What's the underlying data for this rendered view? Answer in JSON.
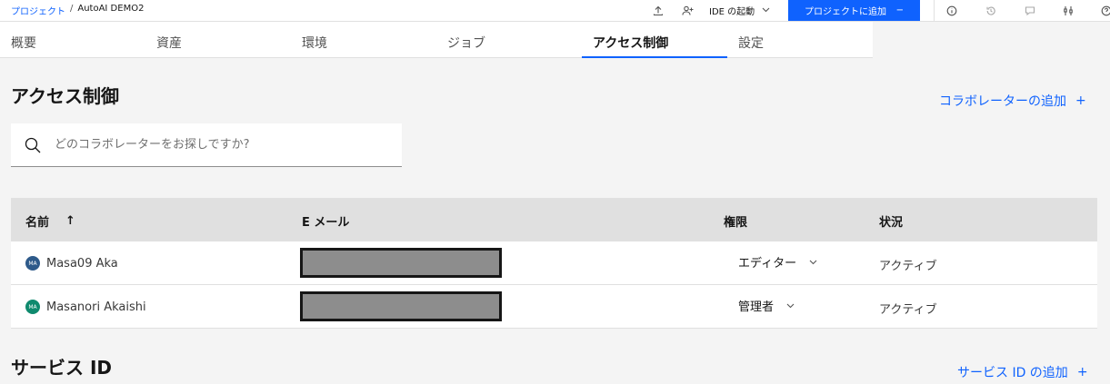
{
  "breadcrumb": {
    "root": "プロジェクト",
    "separator": "/",
    "current": "AutoAI DEMO2"
  },
  "toolbar": {
    "ide_label": "IDE の起動",
    "add_project_label": "プロジェクトに追加",
    "add_project_icon": "−",
    "icons": [
      "upload-icon",
      "add-user-icon",
      "info-icon",
      "history-icon",
      "comment-icon",
      "settings-adjust-icon",
      "help-icon"
    ]
  },
  "tabs": [
    {
      "label": "概要",
      "active": false
    },
    {
      "label": "資産",
      "active": false
    },
    {
      "label": "環境",
      "active": false
    },
    {
      "label": "ジョブ",
      "active": false
    },
    {
      "label": "アクセス制御",
      "active": true
    },
    {
      "label": "設定",
      "active": false
    }
  ],
  "access": {
    "title": "アクセス制御",
    "add_collaborator": "コラボレーターの追加",
    "plus": "+",
    "search_placeholder": "どのコラボレーターをお探しですか?"
  },
  "table": {
    "columns": {
      "name": "名前",
      "email": "E メール",
      "role": "権限",
      "status": "状況"
    },
    "sort_icon": "↑",
    "rows": [
      {
        "initials": "MA",
        "name": "Masa09 Aka",
        "role": "エディター",
        "status": "アクティブ",
        "avatar_color": "#2e5a8a"
      },
      {
        "initials": "MA",
        "name": "Masanori Akaishi",
        "role": "管理者",
        "status": "アクティブ",
        "avatar_color": "#0f8a6e"
      }
    ]
  },
  "service": {
    "title": "サービス ID",
    "add_label": "サービス ID の追加",
    "plus": "+"
  },
  "colors": {
    "accent": "#0f62fe",
    "header_bg": "#e0e0e0",
    "page_bg": "#f4f4f4"
  }
}
